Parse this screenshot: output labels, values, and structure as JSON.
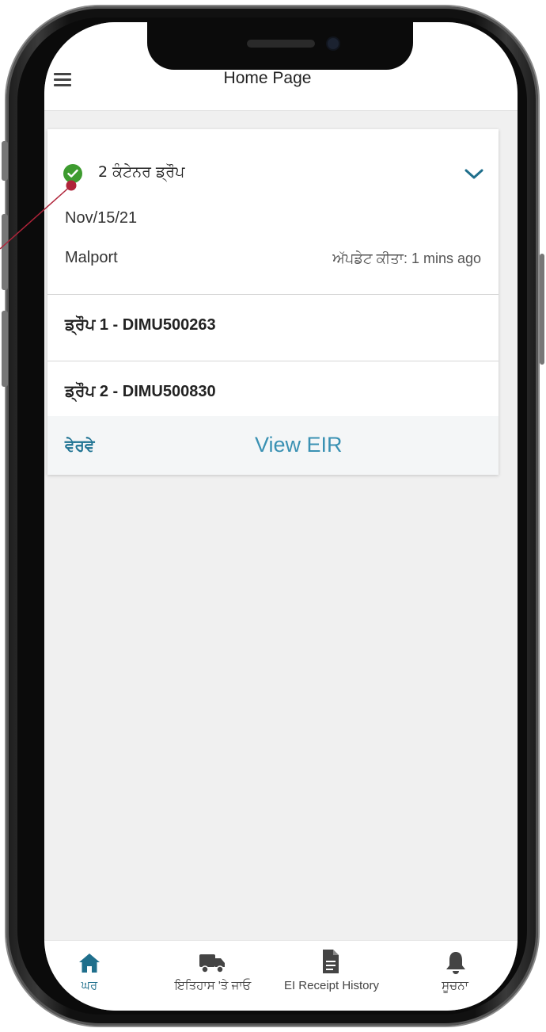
{
  "header": {
    "title": "Home Page"
  },
  "card": {
    "title": "2 ਕੰਟੇਨਰ ਡ੍ਰੌਪ",
    "date": "Nov/15/21",
    "location": "Malport",
    "updated": "ਅੱਪਡੇਟ ਕੀਤਾ: 1 mins ago",
    "drops": [
      {
        "label": "ਡ੍ਰੌਪ 1 - DIMU500263"
      },
      {
        "label": "ਡ੍ਰੌਪ 2 - DIMU500830"
      }
    ],
    "details_link": "ਵੇਰਵੇ",
    "eir_link": "View EIR"
  },
  "tabs": [
    {
      "label": "ਘਰ",
      "icon": "home-icon",
      "active": true
    },
    {
      "label": "ਇਤਿਹਾਸ 'ਤੇ ਜਾਓ",
      "icon": "truck-icon",
      "active": false
    },
    {
      "label": "EI Receipt History",
      "icon": "document-icon",
      "active": false
    },
    {
      "label": "ਸੂਚਨਾ",
      "icon": "bell-icon",
      "active": false
    }
  ],
  "colors": {
    "accent": "#1f6f8c",
    "link": "#3a91b3",
    "success": "#3d9b2f",
    "annotation": "#b0243a"
  }
}
